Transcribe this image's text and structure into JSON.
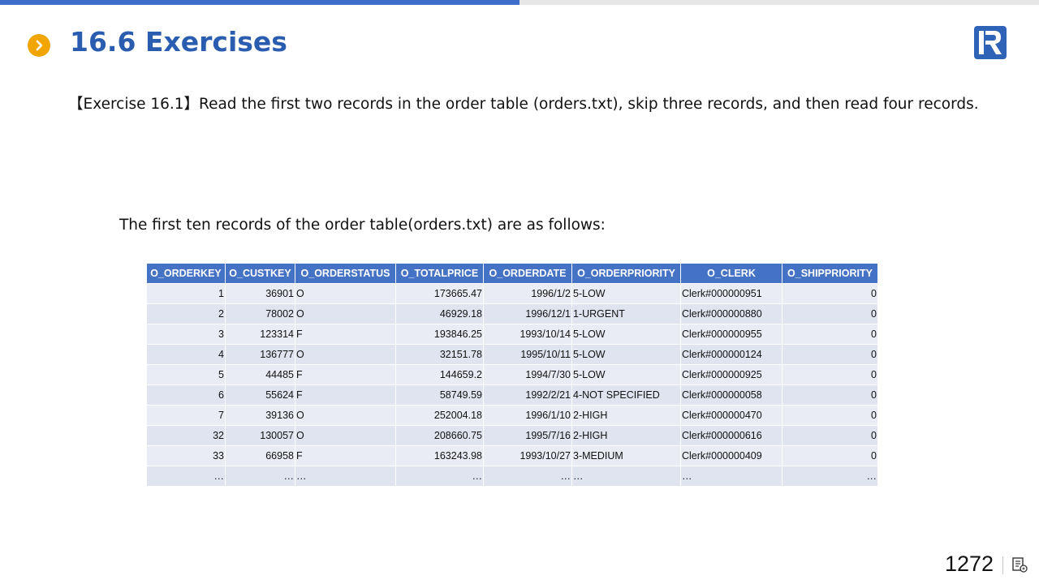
{
  "progress": {
    "fraction": 0.5,
    "color": "#3d6ec9"
  },
  "header": {
    "title": "16.6 Exercises",
    "bullet_icon": "chevron-right-icon",
    "logo_icon": "r-logo-icon"
  },
  "exercise_text": "【Exercise 16.1】Read the first two records in the order table (orders.txt), skip three records, and then read four records.",
  "intro_text": "The first ten records of the order table(orders.txt) are as follows:",
  "table": {
    "columns": [
      "O_ORDERKEY",
      "O_CUSTKEY",
      "O_ORDERSTATUS",
      "O_TOTALPRICE",
      "O_ORDERDATE",
      "O_ORDERPRIORITY",
      "O_CLERK",
      "O_SHIPPRIORITY"
    ],
    "rows": [
      [
        "1",
        "36901",
        "O",
        "173665.47",
        "1996/1/2",
        "5-LOW",
        "Clerk#000000951",
        "0"
      ],
      [
        "2",
        "78002",
        "O",
        "46929.18",
        "1996/12/1",
        "1-URGENT",
        "Clerk#000000880",
        "0"
      ],
      [
        "3",
        "123314",
        "F",
        "193846.25",
        "1993/10/14",
        "5-LOW",
        "Clerk#000000955",
        "0"
      ],
      [
        "4",
        "136777",
        "O",
        "32151.78",
        "1995/10/11",
        "5-LOW",
        "Clerk#000000124",
        "0"
      ],
      [
        "5",
        "44485",
        "F",
        "144659.2",
        "1994/7/30",
        "5-LOW",
        "Clerk#000000925",
        "0"
      ],
      [
        "6",
        "55624",
        "F",
        "58749.59",
        "1992/2/21",
        "4-NOT SPECIFIED",
        "Clerk#000000058",
        "0"
      ],
      [
        "7",
        "39136",
        "O",
        "252004.18",
        "1996/1/10",
        "2-HIGH",
        "Clerk#000000470",
        "0"
      ],
      [
        "32",
        "130057",
        "O",
        "208660.75",
        "1995/7/16",
        "2-HIGH",
        "Clerk#000000616",
        "0"
      ],
      [
        "33",
        "66958",
        "F",
        "163243.98",
        "1993/10/27",
        "3-MEDIUM",
        "Clerk#000000409",
        "0"
      ],
      [
        "…",
        "…",
        "…",
        "…",
        "…",
        "…",
        "…",
        "…"
      ]
    ],
    "header_color": "#4472c4"
  },
  "footer": {
    "page_number": "1272",
    "notes_icon": "notes-icon"
  }
}
